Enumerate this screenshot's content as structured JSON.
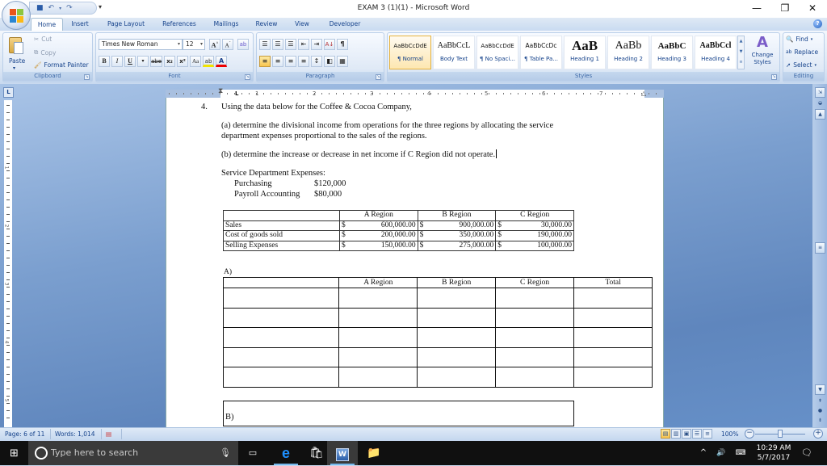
{
  "window": {
    "title": "EXAM 3 (1)(1) - Microsoft Word",
    "controls": {
      "minimize": "—",
      "restore": "❐",
      "close": "✕"
    }
  },
  "quick_access": {
    "save_icon": "💾",
    "undo_icon": "↶",
    "redo_icon": "↷",
    "more": "▾"
  },
  "tabs": [
    {
      "label": "Home",
      "active": true
    },
    {
      "label": "Insert"
    },
    {
      "label": "Page Layout"
    },
    {
      "label": "References"
    },
    {
      "label": "Mailings"
    },
    {
      "label": "Review"
    },
    {
      "label": "View"
    },
    {
      "label": "Developer"
    }
  ],
  "ribbon": {
    "clipboard": {
      "label": "Clipboard",
      "paste": "Paste",
      "cut": "Cut",
      "copy": "Copy",
      "format_painter": "Format Painter"
    },
    "font": {
      "label": "Font",
      "font_name": "Times New Roman",
      "font_size": "12",
      "grow": "A",
      "shrink": "A",
      "clear": "⌫",
      "bold": "B",
      "italic": "I",
      "underline": "U",
      "strike": "abe",
      "subscript": "x₂",
      "superscript": "x²",
      "change_case": "Aa",
      "highlight": "ab",
      "font_color": "A"
    },
    "paragraph": {
      "label": "Paragraph",
      "bullets": "☰",
      "numbering": "☰",
      "multilevel": "☰",
      "decrease_indent": "⇤",
      "increase_indent": "⇥",
      "sort": "A↓",
      "show_marks": "¶",
      "align_left": "≡",
      "center": "≡",
      "align_right": "≡",
      "justify": "≡",
      "line_spacing": "↕",
      "shading": "◧",
      "borders": "▦"
    },
    "styles": {
      "label": "Styles",
      "items": [
        {
          "sample": "AaBbCcDdE",
          "name": "¶ Normal"
        },
        {
          "sample": "AaBbCcL",
          "name": "Body Text"
        },
        {
          "sample": "AaBbCcDdE",
          "name": "¶ No Spaci..."
        },
        {
          "sample": "AaBbCcDc",
          "name": "¶ Table Pa..."
        },
        {
          "sample": "AaB",
          "name": "Heading 1"
        },
        {
          "sample": "AaBb",
          "name": "Heading 2"
        },
        {
          "sample": "AaBbC",
          "name": "Heading 3"
        },
        {
          "sample": "AaBbCcl",
          "name": "Heading 4"
        }
      ],
      "change_styles": "Change Styles"
    },
    "editing": {
      "label": "Editing",
      "find": "Find",
      "replace": "Replace",
      "select": "Select"
    }
  },
  "ruler": {
    "corner": "L",
    "h_numbers": [
      "1",
      "2",
      "3",
      "4",
      "5",
      "6",
      "7"
    ],
    "v_numbers": [
      "1",
      "2",
      "3",
      "4",
      "5"
    ]
  },
  "document": {
    "item_number": "4.",
    "intro": "Using the data below for the Coffee & Cocoa Company,",
    "part_a_line1": "(a) determine the divisional income from operations for the three regions by allocating the service",
    "part_a_line2": "department expenses proportional to the sales of the regions.",
    "part_b": "(b) determine the increase or decrease in net income if C Region did not operate.",
    "service_heading": "Service Department Expenses:",
    "service_items": [
      {
        "label": "Purchasing",
        "value": "$120,000"
      },
      {
        "label": "Payroll Accounting",
        "value": "$80,000"
      }
    ],
    "data_table": {
      "headers": [
        "",
        "A Region",
        "B Region",
        "C Region"
      ],
      "currency": "$",
      "rows": [
        {
          "label": "Sales",
          "values": [
            "600,000.00",
            "900,000.00",
            "30,000.00"
          ]
        },
        {
          "label": "Cost of goods sold",
          "values": [
            "200,000.00",
            "350,000.00",
            "190,000.00"
          ]
        },
        {
          "label": "Selling Expenses",
          "values": [
            "150,000.00",
            "275,000.00",
            "100,000.00"
          ]
        }
      ]
    },
    "answer_a_label": "A)",
    "answer_table": {
      "headers": [
        "",
        "A Region",
        "B Region",
        "C Region",
        "Total"
      ],
      "empty_rows": 5
    },
    "answer_b_label": "B)"
  },
  "statusbar": {
    "page": "Page: 6 of 11",
    "words": "Words: 1,014",
    "zoom": "100%",
    "zoom_level_percent": 100
  },
  "taskbar": {
    "search_placeholder": "Type here to search",
    "time": "10:29 AM",
    "date": "5/7/2017"
  }
}
